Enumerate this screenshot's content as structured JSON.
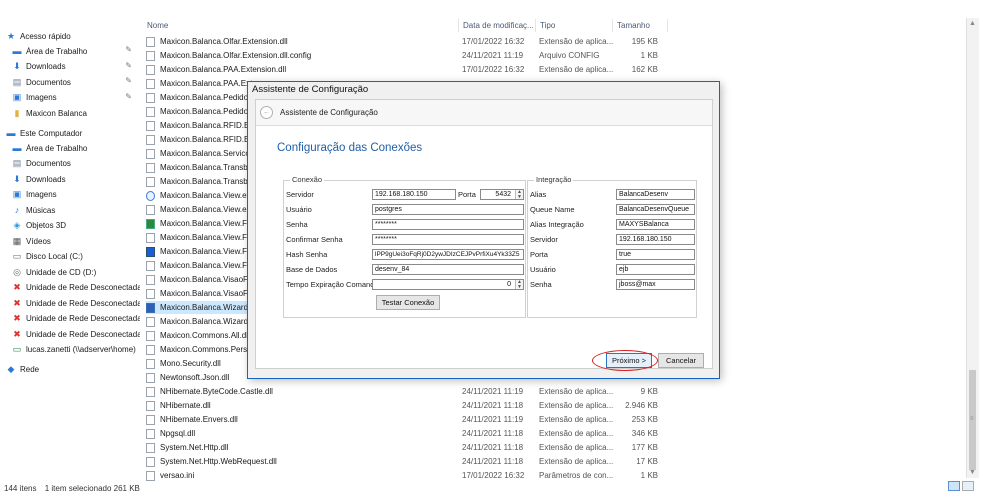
{
  "navigation": {
    "quick_access": "Acesso rápido",
    "pinned": [
      {
        "label": "Área de Trabalho",
        "icon": "desktop-icon"
      },
      {
        "label": "Downloads",
        "icon": "download-icon"
      },
      {
        "label": "Documentos",
        "icon": "document-icon"
      },
      {
        "label": "Imagens",
        "icon": "image-icon"
      },
      {
        "label": "Maxicon Balanca",
        "icon": "folder-icon"
      }
    ],
    "this_pc": "Este Computador",
    "pc_items": [
      {
        "label": "Área de Trabalho",
        "icon": "desktop-icon"
      },
      {
        "label": "Documentos",
        "icon": "document-icon"
      },
      {
        "label": "Downloads",
        "icon": "download-icon"
      },
      {
        "label": "Imagens",
        "icon": "image-icon"
      },
      {
        "label": "Músicas",
        "icon": "music-icon"
      },
      {
        "label": "Objetos 3D",
        "icon": "cube-icon"
      },
      {
        "label": "Vídeos",
        "icon": "video-icon"
      },
      {
        "label": "Disco Local (C:)",
        "icon": "drive-icon"
      },
      {
        "label": "Unidade de CD (D:)",
        "icon": "cd-icon"
      },
      {
        "label": "Unidade de Rede Desconectada",
        "icon": "network-drive-disconnected-icon"
      },
      {
        "label": "Unidade de Rede Desconectada",
        "icon": "network-drive-disconnected-icon"
      },
      {
        "label": "Unidade de Rede Desconectada",
        "icon": "network-drive-disconnected-icon"
      },
      {
        "label": "Unidade de Rede Desconectada",
        "icon": "network-drive-disconnected-icon"
      },
      {
        "label": "lucas.zanetti (\\\\adserver\\home)",
        "icon": "network-drive-icon"
      }
    ],
    "network": "Rede"
  },
  "columns": {
    "name": "Nome",
    "date": "Data de modificaç...",
    "type": "Tipo",
    "size": "Tamanho"
  },
  "files": [
    {
      "name": "Maxicon.Balanca.Olfar.Extension.dll",
      "date": "17/01/2022 16:32",
      "type": "Extensão de aplica...",
      "size": "195 KB"
    },
    {
      "name": "Maxicon.Balanca.Olfar.Extension.dll.config",
      "date": "24/11/2021 11:19",
      "type": "Arquivo CONFIG",
      "size": "1 KB"
    },
    {
      "name": "Maxicon.Balanca.PAA.Extension.dll",
      "date": "17/01/2022 16:32",
      "type": "Extensão de aplica...",
      "size": "162 KB"
    },
    {
      "name": "Maxicon.Balanca.PAA.Exte",
      "date": "",
      "type": "",
      "size": ""
    },
    {
      "name": "Maxicon.Balanca.Pedido.E",
      "date": "",
      "type": "",
      "size": ""
    },
    {
      "name": "Maxicon.Balanca.Pedido.E",
      "date": "",
      "type": "",
      "size": ""
    },
    {
      "name": "Maxicon.Balanca.RFID.Ext",
      "date": "",
      "type": "",
      "size": ""
    },
    {
      "name": "Maxicon.Balanca.RFID.Ext",
      "date": "",
      "type": "",
      "size": ""
    },
    {
      "name": "Maxicon.Balanca.Servico.E",
      "date": "",
      "type": "",
      "size": ""
    },
    {
      "name": "Maxicon.Balanca.Transbor",
      "date": "",
      "type": "",
      "size": ""
    },
    {
      "name": "Maxicon.Balanca.Transbor",
      "date": "",
      "type": "",
      "size": ""
    },
    {
      "name": "Maxicon.Balanca.View.exe",
      "date": "",
      "type": "",
      "size": ""
    },
    {
      "name": "Maxicon.Balanca.View.exe",
      "date": "",
      "type": "",
      "size": ""
    },
    {
      "name": "Maxicon.Balanca.View.Fila",
      "date": "",
      "type": "",
      "size": ""
    },
    {
      "name": "Maxicon.Balanca.View.Fila",
      "date": "",
      "type": "",
      "size": ""
    },
    {
      "name": "Maxicon.Balanca.View.Fila",
      "date": "",
      "type": "",
      "size": ""
    },
    {
      "name": "Maxicon.Balanca.View.Fila",
      "date": "",
      "type": "",
      "size": ""
    },
    {
      "name": "Maxicon.Balanca.VisaoFlu",
      "date": "",
      "type": "",
      "size": ""
    },
    {
      "name": "Maxicon.Balanca.VisaoFlu",
      "date": "",
      "type": "",
      "size": ""
    },
    {
      "name": "Maxicon.Balanca.Wizard.e",
      "date": "",
      "type": "",
      "size": ""
    },
    {
      "name": "Maxicon.Balanca.Wizard.e",
      "date": "",
      "type": "",
      "size": ""
    },
    {
      "name": "Maxicon.Commons.All.dll",
      "date": "",
      "type": "",
      "size": ""
    },
    {
      "name": "Maxicon.Commons.Persist",
      "date": "",
      "type": "",
      "size": ""
    },
    {
      "name": "Mono.Security.dll",
      "date": "",
      "type": "",
      "size": ""
    },
    {
      "name": "Newtonsoft.Json.dll",
      "date": "",
      "type": "",
      "size": ""
    },
    {
      "name": "NHibernate.ByteCode.Castle.dll",
      "date": "24/11/2021 11:19",
      "type": "Extensão de aplica...",
      "size": "9 KB"
    },
    {
      "name": "NHibernate.dll",
      "date": "24/11/2021 11:18",
      "type": "Extensão de aplica...",
      "size": "2.946 KB"
    },
    {
      "name": "NHibernate.Envers.dll",
      "date": "24/11/2021 11:19",
      "type": "Extensão de aplica...",
      "size": "253 KB"
    },
    {
      "name": "Npgsql.dll",
      "date": "24/11/2021 11:18",
      "type": "Extensão de aplica...",
      "size": "346 KB"
    },
    {
      "name": "System.Net.Http.dll",
      "date": "24/11/2021 11:18",
      "type": "Extensão de aplica...",
      "size": "177 KB"
    },
    {
      "name": "System.Net.Http.WebRequest.dll",
      "date": "24/11/2021 11:18",
      "type": "Extensão de aplica...",
      "size": "17 KB"
    },
    {
      "name": "versao.ini",
      "date": "17/01/2022 16:32",
      "type": "Parâmetros de con...",
      "size": "1 KB"
    }
  ],
  "selected_file": "Maxicon.Balanca.Wizard.e",
  "status": {
    "count": "144 itens",
    "selection": "1 item selecionado  261 KB"
  },
  "dialog": {
    "title": "Assistente de Configuração",
    "wizard_header": "Assistente de Configuração",
    "page_title": "Configuração das Conexões",
    "conexao": {
      "legend": "Conexão",
      "servidor_label": "Servidor",
      "servidor_value": "192.168.180.150",
      "porta_label": "Porta",
      "porta_value": "5432",
      "usuario_label": "Usuário",
      "usuario_value": "postgres",
      "senha_label": "Senha",
      "senha_value": "********",
      "confirmar_label": "Confirmar Senha",
      "confirmar_value": "********",
      "hash_label": "Hash Senha",
      "hash_value": "lPP9gUei3oFqRj0D2ywJDIzCEJPvPrfiXu4Yk33Z5",
      "base_label": "Base de Dados",
      "base_value": "desenv_84",
      "tempo_label": "Tempo Expiração Comando",
      "tempo_value": "0",
      "test_button": "Testar Conexão"
    },
    "integracao": {
      "legend": "Integração",
      "alias_label": "Alias",
      "alias_value": "BalancaDesenv",
      "queue_label": "Queue Name",
      "queue_value": "BalancaDesenvQueue",
      "alias_int_label": "Alias Integração",
      "alias_int_value": "MAXYSBalanca",
      "servidor_label": "Servidor",
      "servidor_value": "192.168.180.150",
      "porta_label": "Porta",
      "porta_value": "true",
      "usuario_label": "Usuário",
      "usuario_value": "ejb",
      "senha_label": "Senha",
      "senha_value": "jboss@max"
    },
    "next_button": "Próximo >",
    "cancel_button": "Cancelar"
  }
}
